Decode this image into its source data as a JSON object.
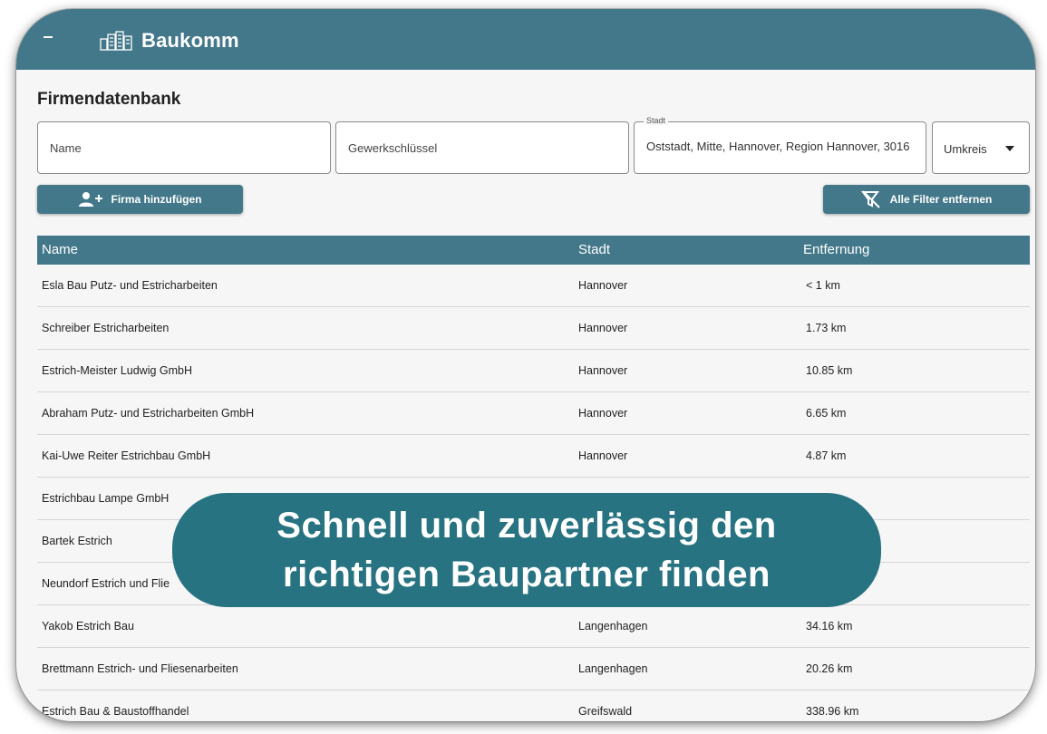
{
  "app": {
    "title": "Baukomm"
  },
  "page": {
    "title": "Firmendatenbank"
  },
  "filters": {
    "name_placeholder": "Name",
    "gewerk_placeholder": "Gewerkschlüssel",
    "stadt_label": "Stadt",
    "stadt_value": "Oststadt, Mitte, Hannover, Region Hannover, 3016",
    "umkreis_value": "Umkreis"
  },
  "buttons": {
    "add_company": "Firma hinzufügen",
    "clear_filters": "Alle Filter entfernen"
  },
  "table": {
    "columns": [
      "Name",
      "Stadt",
      "Entfernung"
    ],
    "rows": [
      [
        "Esla Bau Putz- und Estricharbeiten",
        "Hannover",
        "< 1 km"
      ],
      [
        "Schreiber Estricharbeiten",
        "Hannover",
        "1.73 km"
      ],
      [
        "Estrich-Meister Ludwig GmbH",
        "Hannover",
        "10.85 km"
      ],
      [
        "Abraham Putz- und Estricharbeiten GmbH",
        "Hannover",
        "6.65 km"
      ],
      [
        "Kai-Uwe Reiter Estrichbau GmbH",
        "Hannover",
        "4.87 km"
      ],
      [
        "Estrichbau Lampe GmbH",
        "",
        ""
      ],
      [
        "Bartek Estrich",
        "",
        ""
      ],
      [
        "Neundorf Estrich und Flie",
        "",
        ""
      ],
      [
        "Yakob Estrich Bau",
        "Langenhagen",
        "34.16 km"
      ],
      [
        "Brettmann Estrich- und Fliesenarbeiten",
        "Langenhagen",
        "20.26 km"
      ],
      [
        "Estrich Bau & Baustoffhandel",
        "Greifswald",
        "338.96 km"
      ]
    ]
  },
  "banner": {
    "line1": "Schnell und zuverlässig den",
    "line2": "richtigen Baupartner finden"
  },
  "colors": {
    "primary": "#43788a",
    "banner": "#277381"
  }
}
